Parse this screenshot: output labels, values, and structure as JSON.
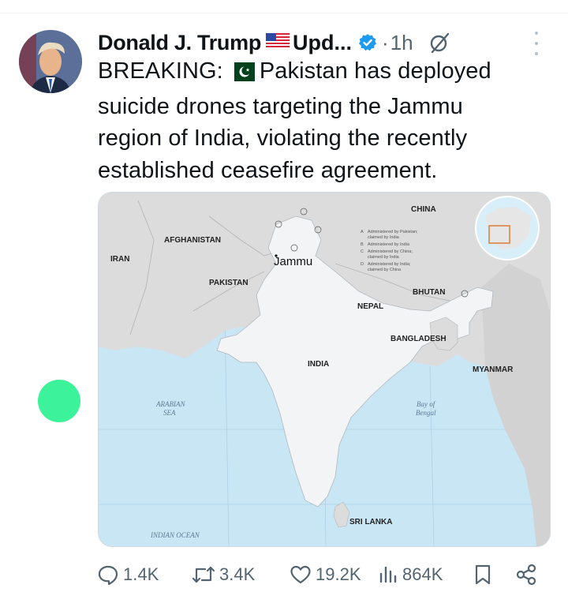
{
  "author": {
    "name": "Donald J. Trump",
    "name_suffix": "Upd...",
    "time": "1h",
    "dot": "·"
  },
  "tweet": {
    "line1_prefix": "BREAKING:",
    "line1_rest": "Pakistan has deployed",
    "line2": "suicide drones targeting the Jammu",
    "line3": "region of India, violating the recently",
    "line4": "established ceasefire agreement."
  },
  "map": {
    "labels": {
      "china": "CHINA",
      "afghanistan": "AFGHANISTAN",
      "iran": "IRAN",
      "pakistan": "PAKISTAN",
      "nepal": "NEPAL",
      "bhutan": "BHUTAN",
      "bangladesh": "BANGLADESH",
      "india": "INDIA",
      "myanmar": "MYANMAR",
      "sri_lanka": "SRI LANKA",
      "jammu": "Jammu",
      "arabian_sea_1": "ARABIAN",
      "arabian_sea_2": "SEA",
      "bay_1": "Bay of",
      "bay_2": "Bengal",
      "indian_ocean": "INDIAN OCEAN"
    },
    "legend": [
      "Administered by Pakistan;",
      "claimed by India",
      "Administered by India",
      "Administered by China;",
      "claimed by India",
      "Administered by India;",
      "claimed by China"
    ],
    "legend_marks": [
      "A",
      "B",
      "C",
      "D"
    ]
  },
  "actions": {
    "replies": "1.4K",
    "reposts": "3.4K",
    "likes": "19.2K",
    "views": "864K"
  },
  "colors": {
    "verified": "#1d9bf0",
    "text": "#0f1419",
    "muted": "#536471",
    "sea": "#c9e6f4",
    "land": "#dcdcdc",
    "india": "#f2f4f5",
    "status_dot": "#3cf29a"
  }
}
